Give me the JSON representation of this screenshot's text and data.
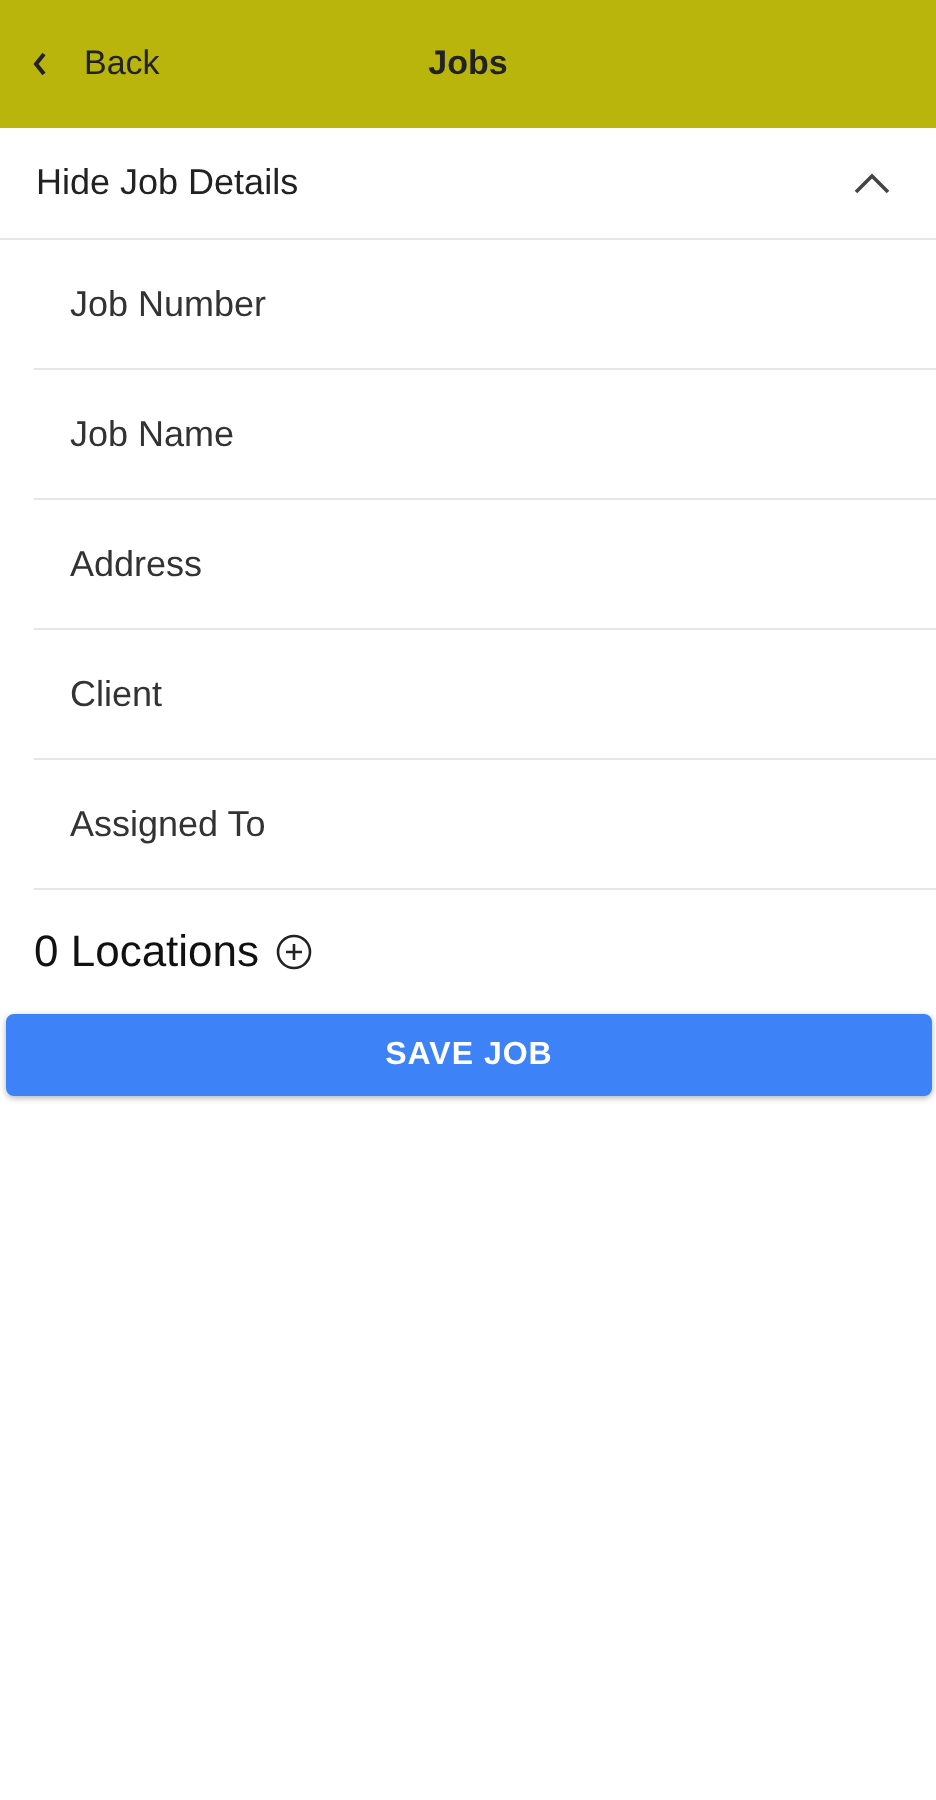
{
  "header": {
    "back_label": "Back",
    "title": "Jobs"
  },
  "job_details": {
    "toggle_label": "Hide Job Details",
    "expanded": true,
    "fields": [
      {
        "placeholder": "Job Number"
      },
      {
        "placeholder": "Job Name"
      },
      {
        "placeholder": "Address"
      },
      {
        "placeholder": "Client"
      },
      {
        "placeholder": "Assigned To"
      }
    ]
  },
  "locations": {
    "label": "0 Locations"
  },
  "save_button": "SAVE JOB"
}
